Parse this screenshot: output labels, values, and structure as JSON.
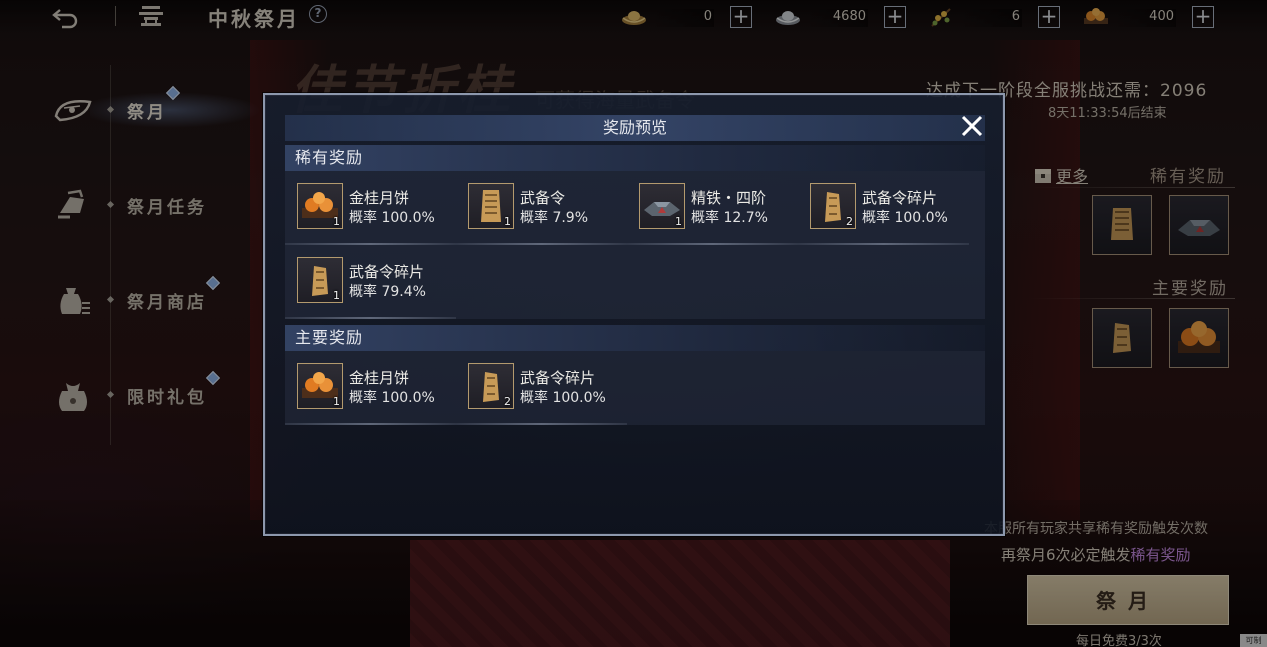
{
  "topbar": {
    "title": "中秋祭月",
    "back_icon": "back-arrow-icon",
    "home_icon": "pavilion-icon",
    "help_label": "?",
    "currencies": [
      {
        "icon": "gold-ingot-icon",
        "value": "0",
        "plus": "+"
      },
      {
        "icon": "silver-ingot-icon",
        "value": "4680",
        "plus": "+"
      },
      {
        "icon": "osmanthus-branch-icon",
        "value": "6",
        "plus": "+"
      },
      {
        "icon": "mooncake-icon",
        "value": "400",
        "plus": "+"
      }
    ]
  },
  "sidebar": {
    "items": [
      {
        "label": "祭月",
        "icon": "fan-icon",
        "active": true,
        "badge": true
      },
      {
        "label": "祭月任务",
        "icon": "hand-scroll-icon",
        "active": false,
        "badge": false
      },
      {
        "label": "祭月商店",
        "icon": "money-bag-icon",
        "active": false,
        "badge": true
      },
      {
        "label": "限时礼包",
        "icon": "gift-pouch-icon",
        "active": false,
        "badge": true
      }
    ]
  },
  "background": {
    "banner": "佳节折桂",
    "banner_sub": "可获得海量武备令"
  },
  "right_panel": {
    "challenge": "达成下一阶段全服挑战还需：2096",
    "countdown": "8天11:33:54后结束",
    "more": "更多",
    "rare_title": "稀有奖励",
    "main_title": "主要奖励",
    "trigger_line1": "本服所有玩家共享稀有奖励触发次数",
    "trigger_line2_prefix": "再祭月6次必定触发",
    "trigger_line2_highlight": "稀有奖励",
    "action_button": "祭月",
    "daily_free": "每日免费3/3次",
    "corner_tag": "可制"
  },
  "modal": {
    "title": "奖励预览",
    "close_icon": "close-x-icon",
    "rare_section": {
      "title": "稀有奖励",
      "items": [
        {
          "name": "金桂月饼",
          "rate": "概率 100.0%",
          "qty": "1",
          "icon": "mooncake-icon"
        },
        {
          "name": "武备令",
          "rate": "概率 7.9%",
          "qty": "1",
          "icon": "token-icon"
        },
        {
          "name": "精铁・四阶",
          "rate": "概率 12.7%",
          "qty": "1",
          "icon": "iron-ingot-icon"
        },
        {
          "name": "武备令碎片",
          "rate": "概率 100.0%",
          "qty": "2",
          "icon": "token-fragment-icon"
        },
        {
          "name": "武备令碎片",
          "rate": "概率 79.4%",
          "qty": "1",
          "icon": "token-fragment-icon"
        }
      ]
    },
    "main_section": {
      "title": "主要奖励",
      "items": [
        {
          "name": "金桂月饼",
          "rate": "概率 100.0%",
          "qty": "1",
          "icon": "mooncake-icon"
        },
        {
          "name": "武备令碎片",
          "rate": "概率 100.0%",
          "qty": "2",
          "icon": "token-fragment-icon"
        }
      ]
    }
  }
}
